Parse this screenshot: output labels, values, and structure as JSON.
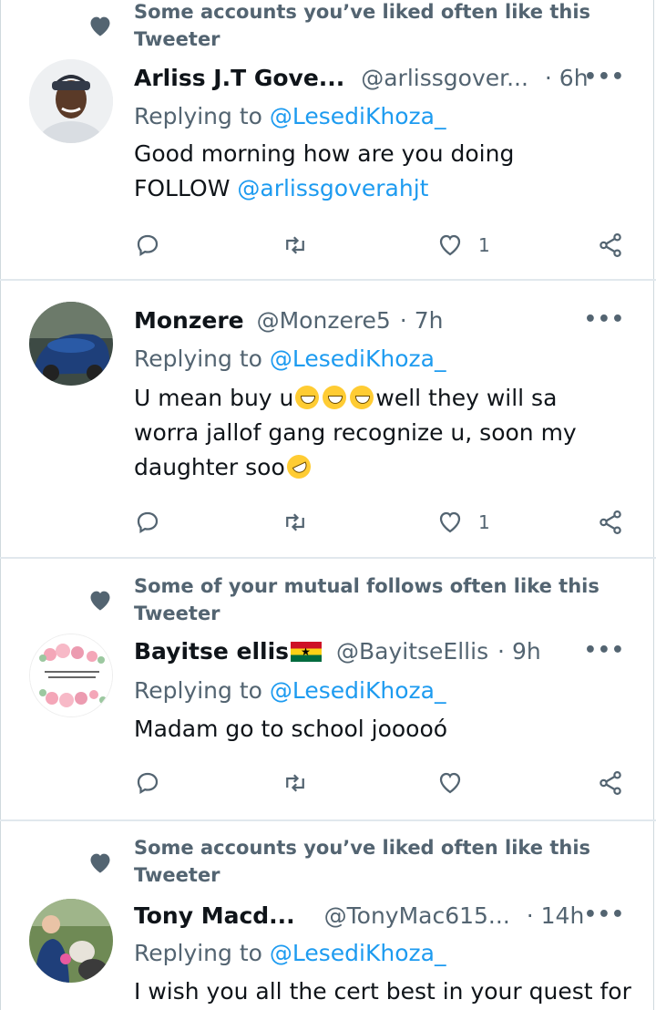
{
  "tweets": [
    {
      "social_context": "Some accounts you’ve liked often like this Tweeter",
      "name": "Arliss J.T Gove...",
      "handle": "@arlissgover...",
      "time": "· 6h",
      "replying_prefix": "Replying to",
      "replying_to": "@LesediKhoza_",
      "body_line1": "Good morning how are you doing",
      "body_line2_text": "FOLLOW ",
      "body_line2_link": "@arlissgoverahjt",
      "like_count": "1"
    },
    {
      "social_context": "",
      "name": "Monzere",
      "handle": "@Monzere5",
      "time": "· 7h",
      "replying_prefix": "Replying to",
      "replying_to": "@LesediKhoza_",
      "body_a": "U mean buy u",
      "body_b": "well they will sa",
      "body_c": "worra jallof gang recognize u, soon my",
      "body_d": "daughter soo",
      "like_count": "1"
    },
    {
      "social_context": "Some of your mutual follows often like this Tweeter",
      "name": "Bayitse ellis",
      "handle": "@BayitseEllis",
      "time": "· 9h",
      "replying_prefix": "Replying to",
      "replying_to": "@LesediKhoza_",
      "body": "Madam go to school jooooó",
      "like_count": "",
      "avatar_text": "Be a blessing to all who cross your path"
    },
    {
      "social_context": "Some accounts you’ve liked often like this Tweeter",
      "name": "Tony Macd...",
      "handle": "@TonyMac615...",
      "time": "· 14h",
      "replying_prefix": "Replying to",
      "replying_to": "@LesediKhoza_",
      "body": "I wish you all the cert best in your quest for"
    }
  ],
  "more_label": "•••",
  "icons": {
    "reply": "reply-icon",
    "retweet": "retweet-icon",
    "like": "heart-icon",
    "share": "share-icon",
    "social": "heart-icon"
  },
  "colors": {
    "link": "#1d9bf0",
    "muted": "#536471",
    "text": "#0f1419"
  }
}
